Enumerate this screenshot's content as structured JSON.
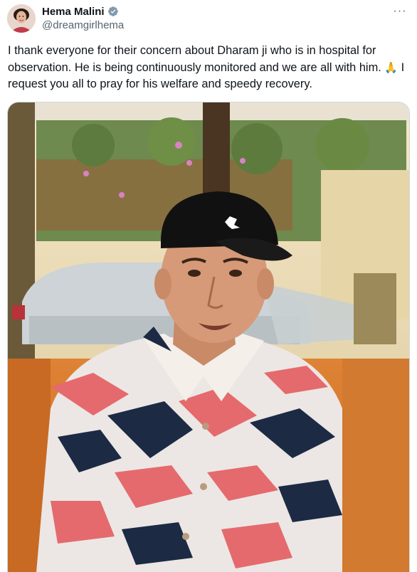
{
  "author": {
    "display_name": "Hema Malini",
    "handle": "@dreamgirlhema",
    "verified": true,
    "verified_color": "#829aab",
    "avatar_icon": "profile-photo"
  },
  "header": {
    "more_icon": "ellipsis-icon",
    "more_glyph": "···"
  },
  "tweet": {
    "text_part1": "I thank everyone for their concern about Dharam ji who is in hospital for observation. He is being continuously monitored and we are all with him. ",
    "emoji": "🙏",
    "text_part2": " I request you all to pray for his welfare and speedy recovery."
  },
  "media": {
    "type": "photo",
    "content": "man-in-black-cap-and-patterned-shirt-on-orange-sofa"
  },
  "colors": {
    "text": "#0f1419",
    "secondary": "#536471",
    "border": "#cfd9de",
    "sofa": "#d9792f",
    "cap": "#111111"
  }
}
